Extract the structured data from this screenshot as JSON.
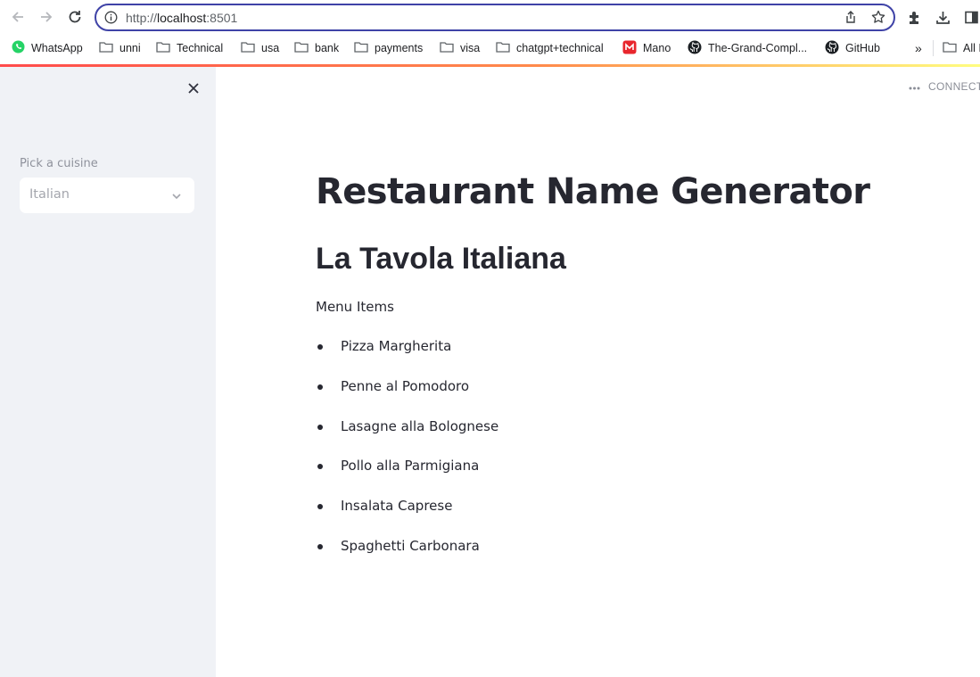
{
  "browser": {
    "url_prefix": "http://",
    "url_host": "localhost",
    "url_suffix": ":8501",
    "icons": [
      "back-icon",
      "forward-icon",
      "reload-icon",
      "info-icon",
      "share-icon",
      "star-icon",
      "extensions-icon",
      "download-icon",
      "sidepanel-icon"
    ]
  },
  "bookmarks": [
    {
      "label": "WhatsApp",
      "icon": "whatsapp-icon"
    },
    {
      "label": "unni",
      "icon": "folder-icon"
    },
    {
      "label": "Technical",
      "icon": "folder-icon"
    },
    {
      "label": "usa",
      "icon": "folder-icon"
    },
    {
      "label": "bank",
      "icon": "folder-icon"
    },
    {
      "label": "payments",
      "icon": "folder-icon"
    },
    {
      "label": "visa",
      "icon": "folder-icon"
    },
    {
      "label": "chatgpt+technical",
      "icon": "folder-icon"
    },
    {
      "label": "Mano",
      "icon": "mano-icon"
    },
    {
      "label": "The-Grand-Compl...",
      "icon": "github-icon"
    },
    {
      "label": "GitHub",
      "icon": "github-icon"
    }
  ],
  "bookmarks_more": "»",
  "bookmarks_all": "All I",
  "sidebar": {
    "select_label": "Pick a cuisine",
    "select_value": "Italian"
  },
  "main": {
    "status": "CONNECTI",
    "title": "Restaurant Name Generator",
    "restaurant_name": "La Tavola Italiana",
    "menu_heading": "Menu Items",
    "menu_items": [
      "Pizza Margherita",
      "Penne al Pomodoro",
      "Lasagne alla Bolognese",
      "Pollo alla Parmigiana",
      "Insalata Caprese",
      "Spaghetti Carbonara"
    ]
  },
  "colors": {
    "accent": "#ff4b4b",
    "omnibox_border": "#3f43a7",
    "sidebar_bg": "#f0f2f6",
    "text": "#262730"
  }
}
